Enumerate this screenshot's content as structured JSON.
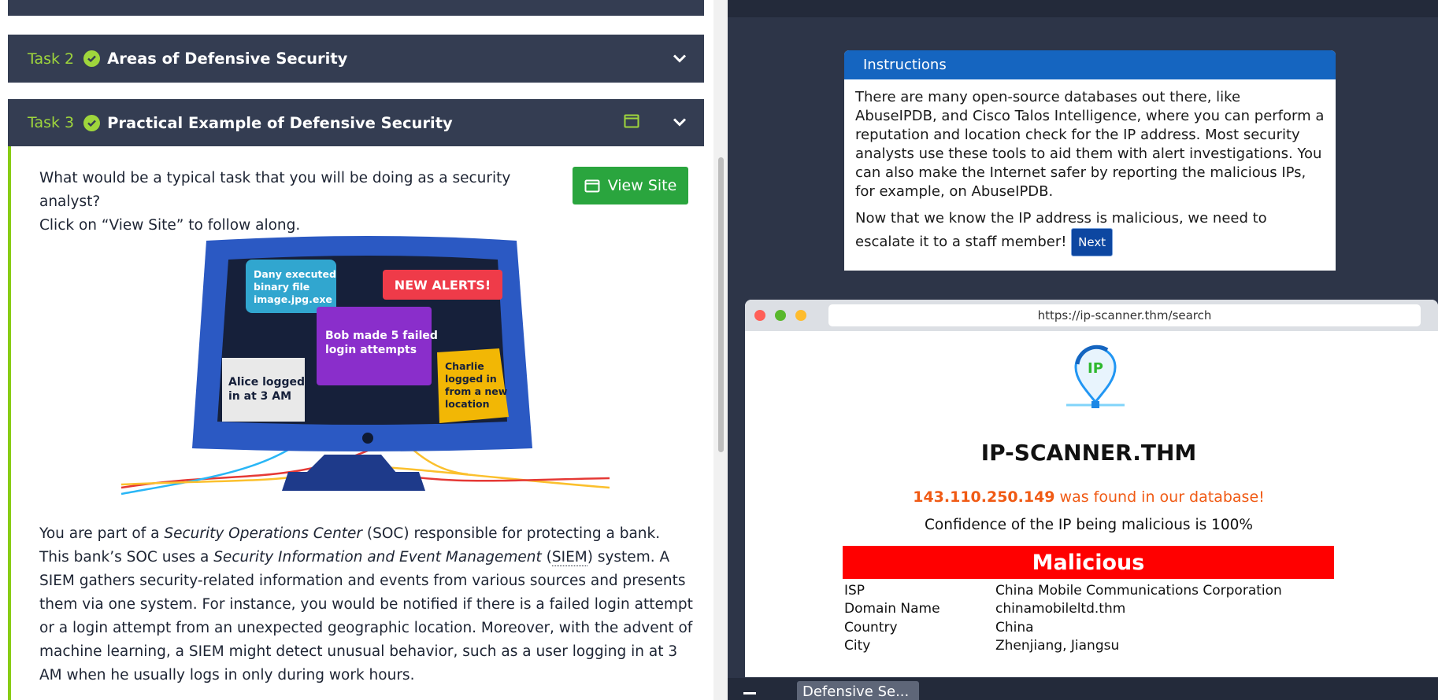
{
  "left_panel": {
    "task2": {
      "number": "Task 2",
      "title": "Areas of Defensive Security"
    },
    "task3": {
      "number": "Task 3",
      "title": "Practical Example of Defensive Security",
      "intro_line1": "What would be a typical task that you will be doing as a security analyst?",
      "intro_line2": "Click on “View Site” to follow along.",
      "view_site_label": "View Site",
      "illustration": {
        "card_dany": [
          "Dany executed",
          "binary file",
          "image.jpg.exe"
        ],
        "card_new_alerts": "NEW ALERTS!",
        "card_bob": [
          "Bob made 5 failed",
          "login attempts"
        ],
        "card_alice": [
          "Alice logged",
          "in at 3 AM"
        ],
        "card_charlie": [
          "Charlie",
          "logged in",
          "from a new",
          "location"
        ]
      },
      "paragraph": {
        "p1": "You are part of a ",
        "soc_italic": "Security Operations Center",
        "p2": " (SOC) responsible for protecting a bank. This bank’s SOC uses a ",
        "siem_italic": "Security Information and Event Management",
        "p3": " (",
        "siem_abbr": "SIEM",
        "p4": ") system. A SIEM gathers security-related information and events from various sources and presents them via one system. For instance, you would be notified if there is a failed login attempt or a login attempt from an unexpected geographic location. Moreover, with the advent of machine learning, a SIEM might detect unusual behavior, such as a user logging in at 3 AM when he usually logs in only during work hours."
      }
    }
  },
  "instructions": {
    "heading": "Instructions",
    "para1": "There are many open-source databases out there, like AbuseIPDB, and Cisco Talos Intelligence, where you can perform a reputation and location check for the IP address. Most security analysts use these tools to aid them with alert investigations. You can also make the Internet safer by reporting the malicious IPs, for example, on AbuseIPDB.",
    "para2": "Now that we know the IP address is malicious, we need to escalate it to a staff member! ",
    "next_label": "Next"
  },
  "browser": {
    "url": "https://ip-scanner.thm/search",
    "logo_text": "IP",
    "site_title": "IP-SCANNER.THM",
    "ip_address": "143.110.250.149",
    "found_text": " was found in our database!",
    "confidence_text": "Confidence of the IP being malicious is 100%",
    "verdict": "Malicious",
    "info": [
      {
        "key": "ISP",
        "value": "China Mobile Communications Corporation"
      },
      {
        "key": "Domain Name",
        "value": "chinamobileltd.thm"
      },
      {
        "key": "Country",
        "value": "China"
      },
      {
        "key": "City",
        "value": "Zhenjiang, Jiangsu"
      }
    ]
  },
  "taskbar": {
    "tab_label": "Defensive Se..."
  },
  "colors": {
    "task_bar_bg": "#343d52",
    "accent_green": "#9fd63c",
    "view_site_green": "#2aa53e",
    "instructions_blue": "#1565c0",
    "malicious_red": "#ff0000",
    "ip_orange": "#f05a14"
  }
}
